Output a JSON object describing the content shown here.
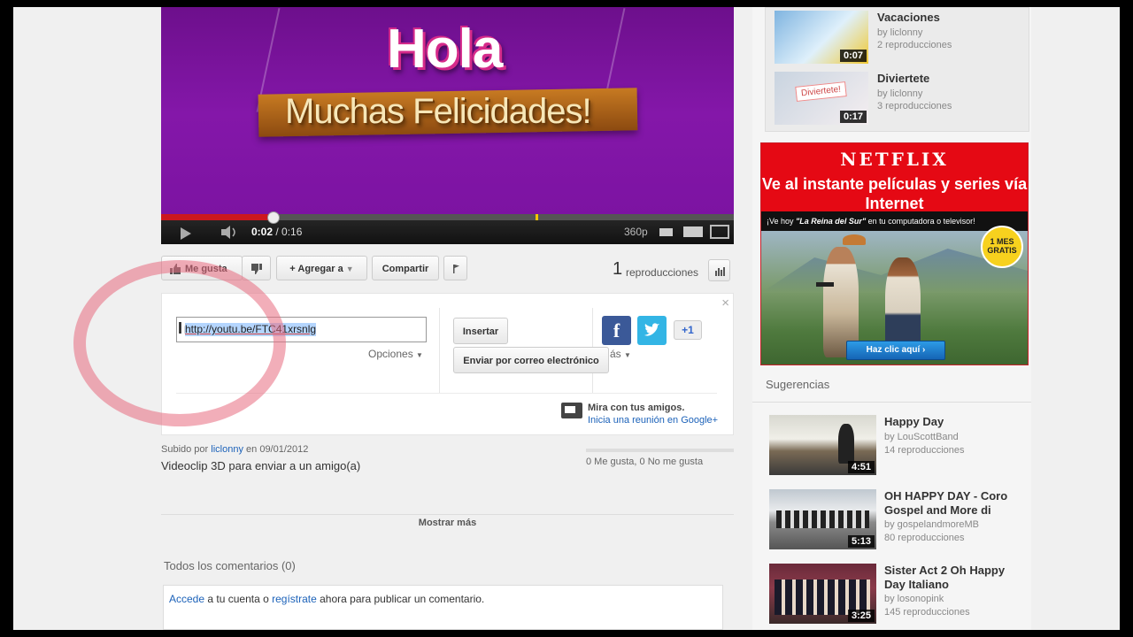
{
  "video": {
    "title_text": "Hola",
    "subtitle_text": "Muchas Felicidades!",
    "time_current": "0:02",
    "time_total": "/ 0:16",
    "quality": "360p",
    "progress": 0.195
  },
  "actions": {
    "like_label": "Me gusta",
    "add_label": "Agregar a",
    "share_label": "Compartir",
    "views_count": "1",
    "views_label": "reproducciones"
  },
  "share": {
    "url": "http://youtu.be/FTC41xrsnlg",
    "options_label": "Opciones",
    "embed_label": "Insertar",
    "email_label": "Enviar por correo electrónico",
    "more_label": "ás",
    "gplus_label": "+1",
    "hangout_title": "Mira con tus amigos.",
    "hangout_link": "Inicia una reunión en Google+",
    "close": "×"
  },
  "meta": {
    "uploaded_prefix": "Subido por",
    "uploader": "liclonny",
    "uploaded_date": "en 09/01/2012",
    "description": "Videoclip 3D para enviar a un amigo(a)",
    "likes_text": "0 Me gusta, 0 No me gusta",
    "show_more": "Mostrar más"
  },
  "comments": {
    "heading": "Todos los comentarios (0)",
    "login_link": "Accede",
    "text_mid": " a tu cuenta o ",
    "register_link": "regístrate",
    "text_end": " ahora para publicar un comentario."
  },
  "sidebar_top": [
    {
      "title": "Vacaciones",
      "by": "by liclonny",
      "views": "2 reproducciones",
      "duration": "0:07"
    },
    {
      "title": "Diviertete",
      "by": "by liclonny",
      "views": "3 reproducciones",
      "duration": "0:17",
      "thumb_text": "Diviertete!"
    }
  ],
  "ad": {
    "logo": "NETFLIX",
    "headline": "Ve al instante películas y series vía Internet",
    "strip_prefix": "¡Ve hoy ",
    "strip_title": "\"La Reina del Sur\"",
    "strip_suffix": " en tu computadora o televisor!",
    "badge": "1 MES GRATIS",
    "cta": "Haz clic aquí"
  },
  "suggestions": {
    "heading": "Sugerencias",
    "items": [
      {
        "title": "Happy Day",
        "by": "by LouScottBand",
        "views": "14 reproducciones",
        "duration": "4:51"
      },
      {
        "title": "OH HAPPY DAY - Coro Gospel and More di",
        "by": "by gospelandmoreMB",
        "views": "80 reproducciones",
        "duration": "5:13"
      },
      {
        "title": "Sister Act 2 Oh Happy Day Italiano",
        "by": "by losonopink",
        "views": "145 reproducciones",
        "duration": "3:25"
      }
    ]
  },
  "colors": {
    "progress": "#cc181e",
    "link": "#1c62b9",
    "netflix_red": "#e50914",
    "highlight_circle": "#e86c80"
  },
  "icons": [
    "thumbs-up-icon",
    "thumbs-down-icon",
    "plus-icon",
    "flag-icon",
    "stats-icon",
    "play-icon",
    "volume-icon",
    "facebook-icon",
    "twitter-icon",
    "hangout-icon",
    "chevron-down-icon"
  ]
}
